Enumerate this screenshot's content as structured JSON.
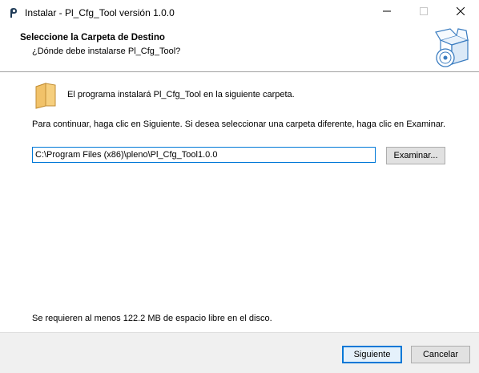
{
  "window": {
    "title": "Instalar - Pl_Cfg_Tool versión 1.0.0",
    "icons": {
      "app": "installer-icon",
      "minimize": "minimize-icon",
      "maximize": "maximize-icon",
      "close": "close-icon"
    }
  },
  "header": {
    "title": "Seleccione la Carpeta de Destino",
    "subtitle": "¿Dónde debe instalarse Pl_Cfg_Tool?",
    "graphic": "box-with-disc-icon"
  },
  "content": {
    "folder_icon": "folder-icon",
    "intro": "El programa instalará Pl_Cfg_Tool en la siguiente carpeta.",
    "instructions": "Para continuar, haga clic en Siguiente. Si desea seleccionar una carpeta diferente, haga clic en Examinar.",
    "path_value": "C:\\Program Files (x86)\\pleno\\Pl_Cfg_Tool1.0.0",
    "browse_label": "Examinar...",
    "space_required": "Se requieren al menos 122.2 MB de espacio libre en el disco."
  },
  "footer": {
    "next_label": "Siguiente",
    "cancel_label": "Cancelar"
  },
  "colors": {
    "accent": "#0078d7",
    "folder": "#f2c46b"
  }
}
